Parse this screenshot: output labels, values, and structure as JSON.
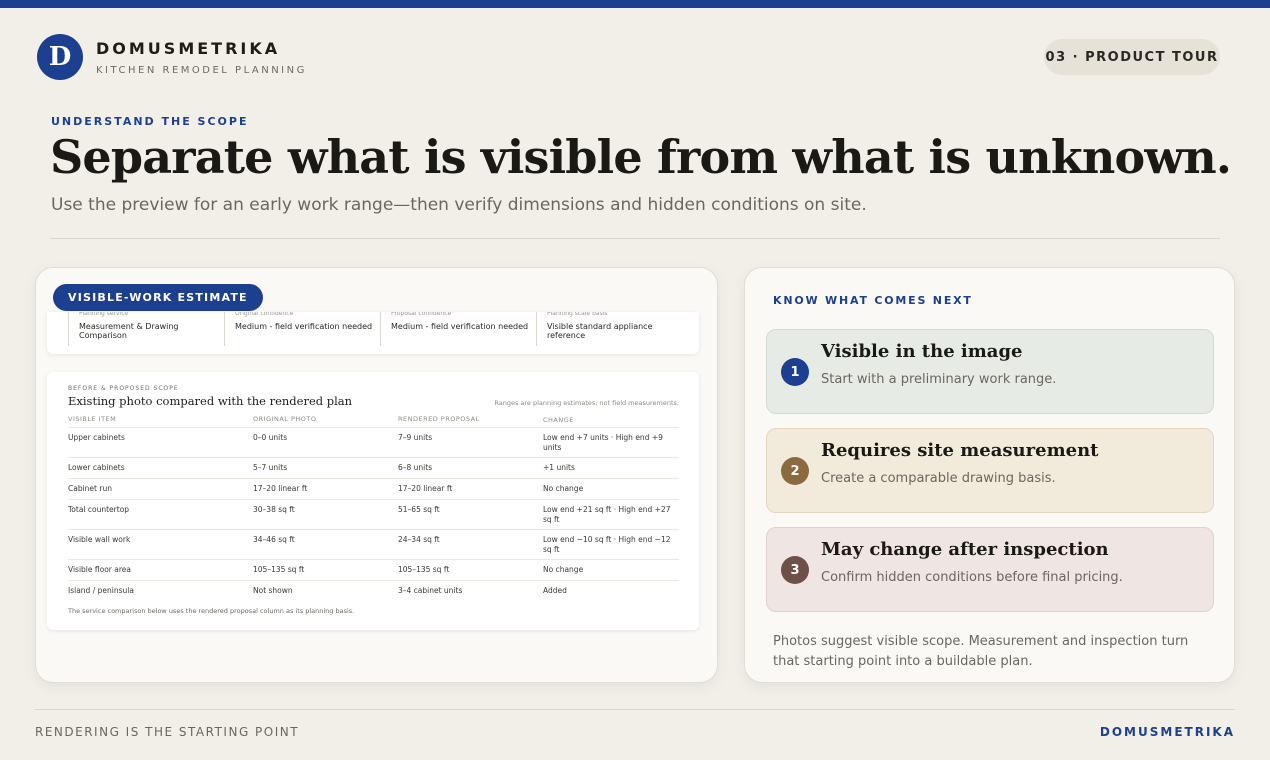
{
  "brand": {
    "logo_letter": "D",
    "name": "DOMUSMETRIKA",
    "tagline": "KITCHEN REMODEL PLANNING"
  },
  "tour_label": "03 · PRODUCT TOUR",
  "hero": {
    "eyebrow": "UNDERSTAND THE SCOPE",
    "title": "Separate what is visible from what is unknown.",
    "subtitle": "Use the preview for an early work range—then verify dimensions and hidden conditions on site."
  },
  "estimate_card": {
    "badge": "VISIBLE-WORK ESTIMATE",
    "summary": [
      {
        "key": "Planning service",
        "value": "Measurement & Drawing Comparison"
      },
      {
        "key": "Original confidence",
        "value": "Medium - field verification needed"
      },
      {
        "key": "Proposal confidence",
        "value": "Medium - field verification needed"
      },
      {
        "key": "Planning scale basis",
        "value": "Visible standard appliance reference"
      }
    ],
    "doc": {
      "eyebrow": "BEFORE & PROPOSED SCOPE",
      "title": "Existing photo compared with the rendered plan",
      "note": "Ranges are planning estimates, not field measurements.",
      "headers": [
        "VISIBLE ITEM",
        "ORIGINAL PHOTO",
        "RENDERED PROPOSAL",
        "CHANGE"
      ],
      "rows": [
        {
          "item": "Upper cabinets",
          "original": "0–0 units",
          "proposal": "7–9 units",
          "change": "Low end +7 units · High end +9 units"
        },
        {
          "item": "Lower cabinets",
          "original": "5–7 units",
          "proposal": "6–8 units",
          "change": "+1 units"
        },
        {
          "item": "Cabinet run",
          "original": "17–20 linear ft",
          "proposal": "17–20 linear ft",
          "change": "No change"
        },
        {
          "item": "Total countertop",
          "original": "30–38 sq ft",
          "proposal": "51–65 sq ft",
          "change": "Low end +21 sq ft · High end +27 sq ft"
        },
        {
          "item": "Visible wall work",
          "original": "34–46 sq ft",
          "proposal": "24–34 sq ft",
          "change": "Low end −10 sq ft · High end −12 sq ft"
        },
        {
          "item": "Visible floor area",
          "original": "105–135 sq ft",
          "proposal": "105–135 sq ft",
          "change": "No change"
        },
        {
          "item": "Island / peninsula",
          "original": "Not shown",
          "proposal": "3–4 cabinet units",
          "change": "Added"
        }
      ],
      "footnote": "The service comparison below uses the rendered proposal column as its planning basis."
    }
  },
  "next_card": {
    "eyebrow": "KNOW WHAT COMES NEXT",
    "steps": [
      {
        "num": "1",
        "title": "Visible in the image",
        "desc": "Start with a preliminary work range.",
        "bg": "#e6ebe5",
        "border": "#cfdcd3",
        "accent": "#1c3f8f"
      },
      {
        "num": "2",
        "title": "Requires site measurement",
        "desc": "Create a comparable drawing basis.",
        "bg": "#f2eadb",
        "border": "#e4d6bc",
        "accent": "#8c6a3f"
      },
      {
        "num": "3",
        "title": "May change after inspection",
        "desc": "Confirm hidden conditions before final pricing.",
        "bg": "#efe5e2",
        "border": "#e0d1cc",
        "accent": "#6e5049"
      }
    ],
    "footer": "Photos suggest visible scope. Measurement and inspection turn that starting point into a buildable plan."
  },
  "footer": {
    "left": "RENDERING IS THE STARTING POINT",
    "right": "DOMUSMETRIKA"
  }
}
